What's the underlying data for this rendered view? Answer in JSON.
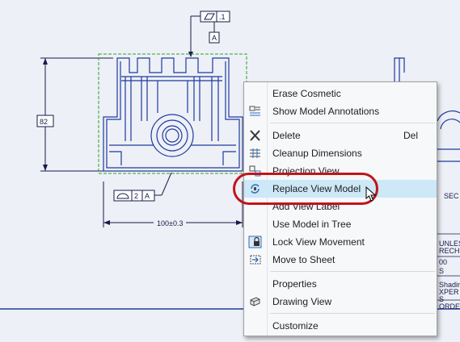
{
  "drawing": {
    "gtol_top": {
      "symbol": "flatness",
      "tolerance": ".1",
      "datum": "A"
    },
    "dim_height": "82",
    "dim_width": "100±0.3",
    "gtol_bottom": {
      "symbol": "profile",
      "tolerance": "2",
      "datum": "A"
    },
    "section_label": "SEC",
    "title_block": [
      "UNLESS",
      "RECHED",
      "00",
      "S",
      "Shading",
      "XPER",
      "S",
      "ORDER"
    ]
  },
  "context_menu": {
    "items": [
      {
        "label": "Erase Cosmetic",
        "icon": "",
        "shortcut": ""
      },
      {
        "label": "Show Model Annotations",
        "icon": "show-annotations-icon",
        "shortcut": ""
      },
      {
        "label": "Delete",
        "icon": "delete-x-icon",
        "shortcut": "Del"
      },
      {
        "label": "Cleanup Dimensions",
        "icon": "cleanup-dimensions-icon",
        "shortcut": ""
      },
      {
        "label": "Projection View",
        "icon": "projection-view-icon",
        "shortcut": ""
      },
      {
        "label": "Replace View Model",
        "icon": "replace-model-icon",
        "shortcut": "",
        "highlighted": true
      },
      {
        "label": "Add View Label",
        "icon": "",
        "shortcut": ""
      },
      {
        "label": "Use Model in Tree",
        "icon": "",
        "shortcut": ""
      },
      {
        "label": "Lock View Movement",
        "icon": "lock-icon",
        "shortcut": ""
      },
      {
        "label": "Move to Sheet",
        "icon": "move-to-sheet-icon",
        "shortcut": ""
      },
      {
        "label": "Properties",
        "icon": "",
        "shortcut": ""
      },
      {
        "label": "Drawing View",
        "icon": "drawing-view-icon",
        "shortcut": ""
      },
      {
        "label": "Customize",
        "icon": "",
        "shortcut": ""
      }
    ]
  },
  "colors": {
    "sheet_background": "#edf0f6",
    "geometry": "#1f3a9e",
    "dimension": "#1a1a4a",
    "selection_box": "#29a329",
    "menu_highlight": "#cde8f7",
    "callout": "#c0141a"
  }
}
